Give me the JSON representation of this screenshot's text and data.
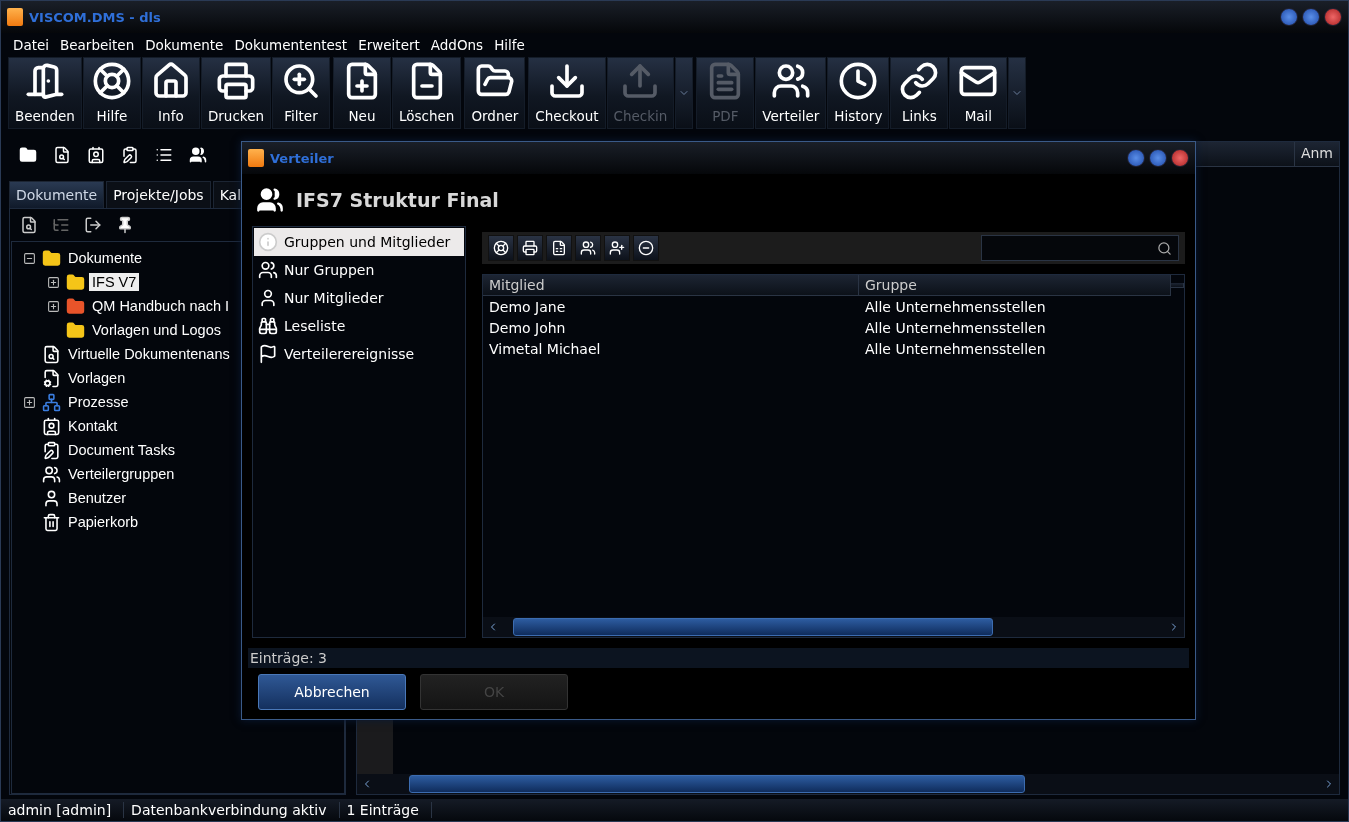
{
  "window": {
    "title": "VISCOM.DMS - dls"
  },
  "menu": [
    "Datei",
    "Bearbeiten",
    "Dokumente",
    "Dokumententest",
    "Erweitert",
    "AddOns",
    "Hilfe"
  ],
  "toolbar": [
    {
      "buttons": [
        {
          "label": "Beenden",
          "disabled": false
        },
        {
          "label": "Hilfe",
          "disabled": false
        },
        {
          "label": "Info",
          "disabled": false
        },
        {
          "label": "Drucken",
          "disabled": false
        },
        {
          "label": "Filter",
          "disabled": false
        }
      ]
    },
    {
      "buttons": [
        {
          "label": "Neu",
          "disabled": false
        },
        {
          "label": "Löschen",
          "disabled": false
        }
      ]
    },
    {
      "buttons": [
        {
          "label": "Ordner",
          "disabled": false
        }
      ]
    },
    {
      "dropdown": true,
      "buttons": [
        {
          "label": "Checkout",
          "disabled": false
        },
        {
          "label": "Checkin",
          "disabled": true
        }
      ]
    },
    {
      "dropdown": true,
      "buttons": [
        {
          "label": "PDF",
          "disabled": true
        },
        {
          "label": "Verteiler",
          "disabled": false
        },
        {
          "label": "History",
          "disabled": false
        },
        {
          "label": "Links",
          "disabled": false
        },
        {
          "label": "Mail",
          "disabled": false
        }
      ]
    }
  ],
  "tabs": [
    {
      "label": "Dokumente",
      "selected": true
    },
    {
      "label": "Projekte/Jobs",
      "selected": false
    },
    {
      "label": "Kal",
      "selected": false
    }
  ],
  "tree": [
    {
      "label": "Dokumente",
      "kind": "folder",
      "selected": false,
      "expanded": true,
      "children": [
        {
          "label": "IFS V7",
          "kind": "folder",
          "selected": true,
          "expanded": false
        },
        {
          "label": "QM Handbuch nach I",
          "kind": "special",
          "selected": false,
          "expanded": false
        },
        {
          "label": "Vorlagen und Logos",
          "kind": "folder",
          "selected": false
        }
      ]
    },
    {
      "label": "Virtuelle Dokumentenans",
      "kind": "view",
      "selected": false
    },
    {
      "label": "Vorlagen",
      "kind": "template",
      "selected": false
    },
    {
      "label": "Prozesse",
      "kind": "process",
      "selected": false,
      "expanded": false
    },
    {
      "label": "Kontakt",
      "kind": "contact",
      "selected": false
    },
    {
      "label": "Document Tasks",
      "kind": "tasks",
      "selected": false
    },
    {
      "label": "Verteilergruppen",
      "kind": "groups",
      "selected": false
    },
    {
      "label": "Benutzer",
      "kind": "user",
      "selected": false
    },
    {
      "label": "Papierkorb",
      "kind": "trash",
      "selected": false
    }
  ],
  "main_table": {
    "columns": [
      "Anm"
    ]
  },
  "status_bar": [
    "admin [admin]",
    "Datenbankverbindung aktiv",
    "1 Einträge"
  ],
  "dialog": {
    "title": "Verteiler",
    "heading": "IFS7 Struktur Final",
    "nav": [
      {
        "label": "Gruppen und Mitglieder",
        "kind": "info",
        "selected": true
      },
      {
        "label": "Nur Gruppen",
        "kind": "groups",
        "selected": false
      },
      {
        "label": "Nur Mitglieder",
        "kind": "user",
        "selected": false
      },
      {
        "label": "Leseliste",
        "kind": "binoculars",
        "selected": false
      },
      {
        "label": "Verteilerereignisse",
        "kind": "flag",
        "selected": false
      }
    ],
    "table": {
      "columns": [
        "Mitglied",
        "Gruppe"
      ],
      "rows": [
        [
          "Demo Jane",
          "Alle Unternehmensstellen"
        ],
        [
          "Demo John",
          "Alle Unternehmensstellen"
        ],
        [
          "Vimetal Michael",
          "Alle Unternehmensstellen"
        ]
      ]
    },
    "count": "Einträge: 3",
    "buttons": [
      {
        "label": "Abbrechen",
        "disabled": false
      },
      {
        "label": "OK",
        "disabled": true
      }
    ]
  }
}
